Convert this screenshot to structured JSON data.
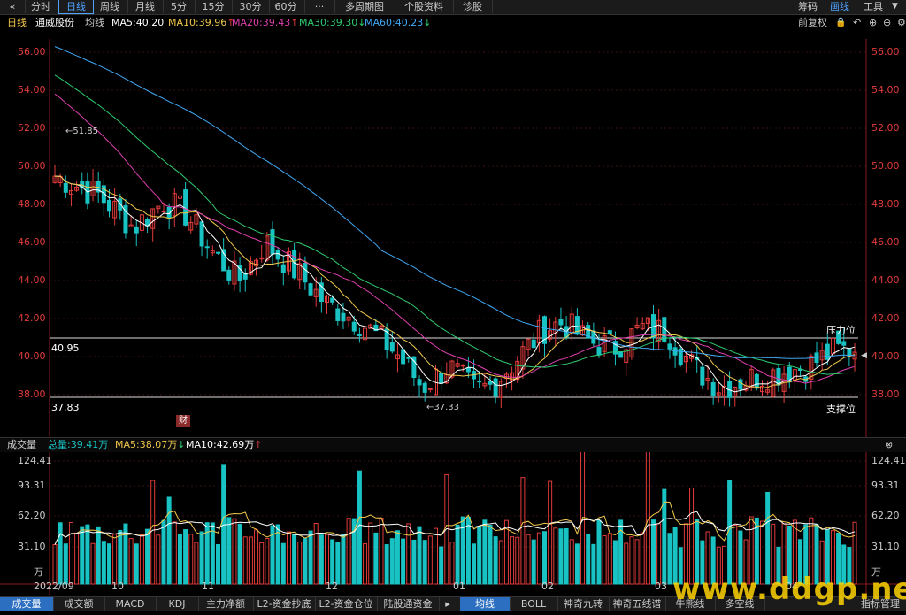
{
  "toolbar": {
    "back": "«",
    "items": [
      "分时",
      "日线",
      "周线",
      "月线",
      "5分",
      "15分",
      "30分",
      "60分",
      "···",
      "多周期图",
      "个股资料",
      "诊股"
    ],
    "active_index": 1,
    "right": [
      "筹码",
      "画线",
      "工具"
    ],
    "right_active_index": 1
  },
  "info": {
    "period": "日线",
    "name": "通威股份",
    "ma_label": "均线",
    "ma5": "MA5:40.20",
    "ma10": "MA10:39.96",
    "ma20": "MA20:39.43",
    "ma30": "MA30:39.30",
    "ma60": "MA60:40.23",
    "ma10_arrow": "↑",
    "ma20_arrow": "↑",
    "ma30_arrow": "↓",
    "ma60_arrow": "↓",
    "fq": "前复权",
    "colors": {
      "ma5": "#ffffff",
      "ma10": "#f2c94c",
      "ma20": "#e040b0",
      "ma30": "#2ecc71",
      "ma60": "#3fa9f5",
      "up": "#e23b3b",
      "down": "#19c3c3"
    }
  },
  "price_axis": [
    "56.00",
    "54.00",
    "52.00",
    "50.00",
    "48.00",
    "46.00",
    "44.00",
    "42.00",
    "40.00",
    "38.00"
  ],
  "annotations": {
    "high": "51.85",
    "low": "37.33",
    "resistance_value": "40.95",
    "support_value": "37.83",
    "resistance_label": "压力位",
    "support_label": "支撑位",
    "cai": "财"
  },
  "volume": {
    "title": "成交量",
    "total": "总量:39.41万",
    "ma5": "MA5:38.07万",
    "ma10": "MA10:42.69万",
    "ma5_arrow": "↓",
    "ma10_arrow": "↑",
    "axis": [
      "124.41",
      "93.31",
      "62.20",
      "31.10",
      "万"
    ]
  },
  "date_axis": [
    "2022/09",
    "10",
    "11",
    "12",
    "01",
    "02",
    "03",
    "04"
  ],
  "bottom_tabs": [
    "成交量",
    "成交额",
    "MACD",
    "KDJ",
    "主力净额",
    "L2-资金抄底",
    "L2-资金仓位",
    "陆股通资金",
    "均线",
    "BOLL",
    "神奇九转",
    "神奇五线谱",
    "牛熊线",
    "多空线",
    "指标管理"
  ],
  "bottom_active": [
    0,
    8
  ],
  "watermark": "www.ddgp.net"
}
